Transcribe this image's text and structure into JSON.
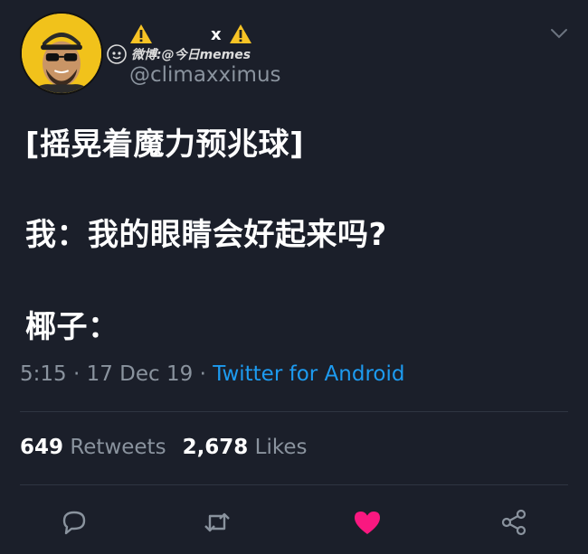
{
  "user": {
    "display_name_mark": "x",
    "handle": "@climaxximus"
  },
  "watermark": {
    "text": "微博:@今日memes"
  },
  "tweet": {
    "lines": [
      "[摇晃着魔力预兆球]",
      "我：我的眼睛会好起来吗?",
      "椰子："
    ],
    "time": "5:15",
    "sep1": " · ",
    "date": "17 Dec 19",
    "sep2": " · ",
    "source": "Twitter for Android"
  },
  "stats": {
    "retweets_count": "649",
    "retweets_label": "Retweets",
    "likes_count": "2,678",
    "likes_label": "Likes"
  },
  "colors": {
    "background": "#1b1f2a",
    "text": "#ffffff",
    "muted": "#8a939e",
    "link": "#1d9bf0",
    "like": "#f91880"
  },
  "icons": [
    "warning-icon",
    "warning-icon",
    "weibo-logo-icon",
    "chevron-down-icon",
    "reply-icon",
    "retweet-icon",
    "heart-icon",
    "share-icon"
  ]
}
